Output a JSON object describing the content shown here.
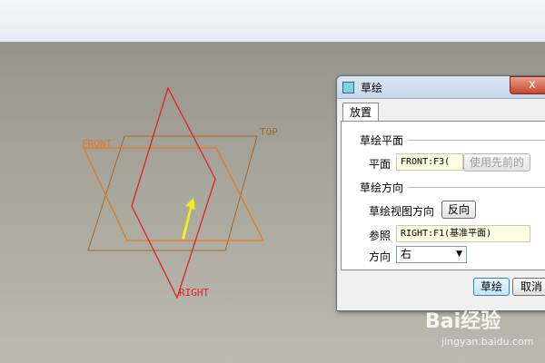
{
  "viewport": {
    "plane_labels": {
      "front": "FRONT",
      "top": "TOP",
      "right": "RIGHT"
    },
    "colors": {
      "front": "#e07820",
      "top": "#a0682e",
      "right": "#e0202a",
      "arrow": "#f2f018"
    }
  },
  "dialog": {
    "title": "草绘",
    "close_label": "x",
    "tab_label": "放置",
    "plane_section": "草绘平面",
    "plane_label": "平面",
    "plane_value": "FRONT:F3(",
    "use_previous_button": "使用先前的",
    "orientation_section": "草绘方向",
    "view_dir_label": "草绘视图方向",
    "flip_button": "反向",
    "reference_label": "参照",
    "reference_value": "RIGHT:F1(基准平面)",
    "direction_label": "方向",
    "direction_value": "右",
    "sketch_button": "草绘",
    "cancel_button": "取消"
  },
  "watermark": {
    "brand": "Bai经验",
    "url": "jingyan.baidu.com"
  }
}
